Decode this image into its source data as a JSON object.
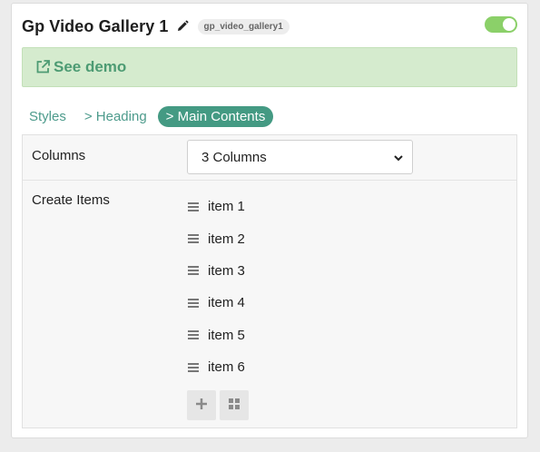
{
  "header": {
    "title": "Gp Video Gallery 1",
    "slug": "gp_video_gallery1",
    "toggle_on": true
  },
  "demo": {
    "label": "See demo"
  },
  "tabs": [
    {
      "label": "Styles",
      "active": false
    },
    {
      "label": "> Heading",
      "active": false
    },
    {
      "label": "> Main Contents",
      "active": true
    }
  ],
  "fields": {
    "columns_label": "Columns",
    "columns_value": "3 Columns",
    "items_label": "Create Items"
  },
  "items": [
    "item 1",
    "item 2",
    "item 3",
    "item 4",
    "item 5",
    "item 6"
  ],
  "icons": {
    "edit": "pencil-icon",
    "demo": "external-link-icon",
    "drag": "drag-handle-icon",
    "add": "plus-icon",
    "grid": "grid-icon",
    "select": "chevron-down-icon"
  },
  "colors": {
    "accent": "#449a83",
    "demo_bg": "#d5ebce",
    "toggle": "#8bd069"
  }
}
